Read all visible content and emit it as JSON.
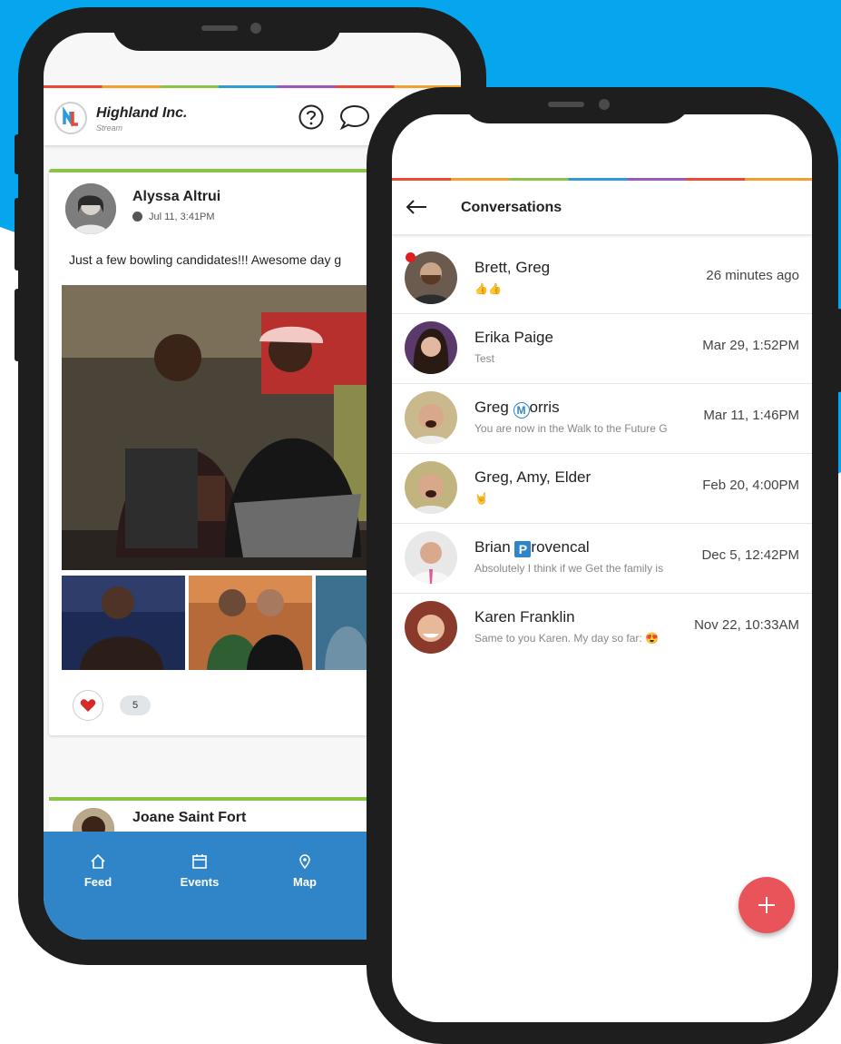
{
  "colors": {
    "brand_blue": "#05a6ee",
    "tabbar": "#2f85c8",
    "fab": "#e9535a",
    "accent_green": "#8ac34a"
  },
  "feed_app": {
    "title": "Highland Inc.",
    "subtitle": "Stream",
    "header_icons": [
      "help-icon",
      "chat-icon"
    ],
    "post": {
      "author": "Alyssa Altrui",
      "timestamp": "Jul 11, 3:41PM",
      "text": "Just a few bowling candidates!!! Awesome day g",
      "like_count": "5"
    },
    "next_post": {
      "author": "Joane Saint Fort"
    },
    "tabs": [
      {
        "label": "Feed",
        "icon": "home-icon"
      },
      {
        "label": "Events",
        "icon": "calendar-icon"
      },
      {
        "label": "Map",
        "icon": "map-pin-icon"
      }
    ]
  },
  "conversations_app": {
    "title": "Conversations",
    "items": [
      {
        "name": "Brett, Greg",
        "preview": "👍👍",
        "time": "26 minutes ago",
        "unread": true
      },
      {
        "name": "Erika Paige",
        "preview": "Test",
        "time": "Mar 29, 1:52PM"
      },
      {
        "name_before": "Greg ",
        "name_badge": "M",
        "name_after": "orris",
        "preview": "You are now in the Walk to the Future G",
        "time": "Mar 11, 1:46PM"
      },
      {
        "name": "Greg, Amy, Elder",
        "preview": "🤘",
        "time": "Feb 20, 4:00PM"
      },
      {
        "name_before": "Brian ",
        "name_badge": "P",
        "name_after": "rovencal",
        "preview": "Absolutely I think if we Get the family is",
        "time": "Dec 5, 12:42PM"
      },
      {
        "name": "Karen Franklin",
        "preview": "Same to you Karen. My day so far: 😍",
        "time": "Nov 22, 10:33AM"
      }
    ]
  }
}
